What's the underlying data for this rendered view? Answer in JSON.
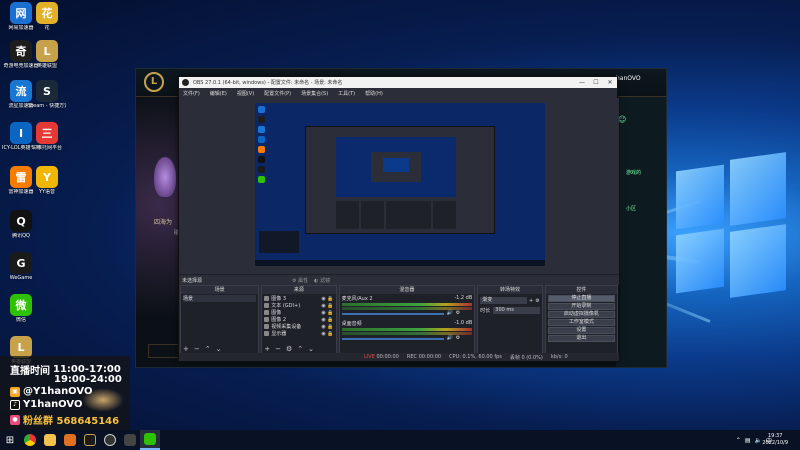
{
  "desktop": {
    "icons": [
      {
        "label": "网易加速器",
        "color": "#1a6fd1",
        "glyph": "网"
      },
      {
        "label": "花",
        "color": "#e3b02a",
        "glyph": "花"
      },
      {
        "label": "奇游电竞加速器",
        "color": "#1d1d1d",
        "glyph": "奇"
      },
      {
        "label": "英雄联盟",
        "color": "#c8a24a",
        "glyph": "L"
      },
      {
        "label": "流星加速器",
        "color": "#1976d2",
        "glyph": "流"
      },
      {
        "label": "Steam - 快捷方式",
        "color": "#1b2838",
        "glyph": "S"
      },
      {
        "label": "ICY-LOL英雄专用版",
        "color": "#0b66c3",
        "glyph": "I"
      },
      {
        "label": "三维托网平台",
        "color": "#e53935",
        "glyph": "三"
      },
      {
        "label": "雷神加速器",
        "color": "#f57c00",
        "glyph": "雷"
      },
      {
        "label": "YY语音",
        "color": "#f2b705",
        "glyph": "Y"
      },
      {
        "label": "腾讯QQ",
        "color": "#111",
        "glyph": "Q"
      },
      {
        "label": "WeGame",
        "color": "#1a1a1a",
        "glyph": "G"
      },
      {
        "label": "微信",
        "color": "#2dc100",
        "glyph": "微"
      },
      {
        "label": "英雄联盟",
        "color": "#c8a24a",
        "glyph": "L"
      }
    ]
  },
  "lol_client": {
    "right_text_1": "hanOVO",
    "right_text_2": "游戏的",
    "right_text_3": "小区",
    "left_text": "四海为",
    "left_text_2": "碰"
  },
  "obs": {
    "title": "OBS 27.0.1 (64-bit, windows) - 配置文件: 未命名 - 场景: 未命名",
    "menu": [
      "文件(F)",
      "编辑(E)",
      "视图(V)",
      "配置文件(P)",
      "场景集合(S)",
      "工具(T)",
      "帮助(H)"
    ],
    "status_left": "未选择源",
    "status_btn1": "属性",
    "status_btn2": "滤镜",
    "docks": {
      "scenes_title": "场景",
      "scenes": [
        "场景"
      ],
      "sources_title": "来源",
      "sources": [
        "图像 3",
        "文本 (GDI+)",
        "图像",
        "图像 2",
        "视频采集设备",
        "显示器"
      ],
      "mixer_title": "混音器",
      "mixer": [
        {
          "name": "麦克风/Aux 2",
          "db": "-1.2 dB"
        },
        {
          "name": "桌面音频",
          "db": "-1.0 dB"
        }
      ],
      "transitions_title": "转场特效",
      "transition_type": "渐变",
      "duration_label": "时长",
      "duration_value": "300 ms",
      "controls_title": "控件",
      "controls": [
        "停止直播",
        "开始录制",
        "启动虚拟摄像机",
        "工作室模式",
        "设置",
        "退出"
      ]
    },
    "footer": {
      "live_label": "LIVE",
      "live_time": "00:00:00",
      "rec_label": "REC",
      "rec_time": "00:00:00",
      "cpu": "CPU: 0.1%, 60.00 fps",
      "dropped": "丢帧 0 (0.0%)",
      "kbps": "kb/s: 0"
    }
  },
  "overlay": {
    "schedule_label": "直播时间",
    "schedule_1": "11:00-17:00",
    "schedule_2": "19:00-24:00",
    "handle_1": "@Y1hanOVO",
    "handle_2": "Y1hanOVO",
    "fan_group": "粉丝群 568645146"
  },
  "taskbar": {
    "time": "19:37",
    "date": "2022/10/9",
    "ime": "中"
  }
}
